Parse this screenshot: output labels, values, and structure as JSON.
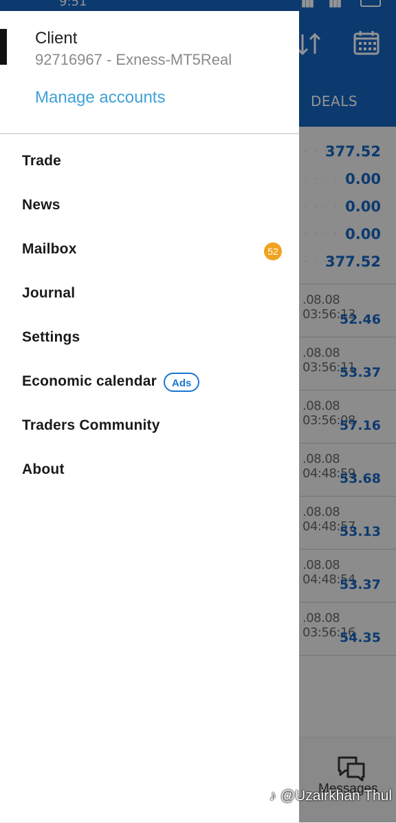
{
  "status_bar": {
    "time": "9:51"
  },
  "drawer": {
    "account": {
      "name": "Client",
      "subtitle": "92716967 - Exness-MT5Real",
      "manage_label": "Manage accounts"
    },
    "menu": [
      {
        "label": "Trade"
      },
      {
        "label": "News"
      },
      {
        "label": "Mailbox",
        "badge": "52"
      },
      {
        "label": "Journal"
      },
      {
        "label": "Settings"
      },
      {
        "label": "Economic calendar",
        "tag": "Ads"
      },
      {
        "label": "Traders Community"
      },
      {
        "label": "About"
      }
    ]
  },
  "background": {
    "tab": "DEALS",
    "summary": [
      "377.52",
      "0.00",
      "0.00",
      "0.00",
      "377.52"
    ],
    "deals": [
      {
        "time": ".08.08 03:56:13",
        "amount": "52.46"
      },
      {
        "time": ".08.08 03:56:11",
        "amount": "53.37"
      },
      {
        "time": ".08.08 03:56:08",
        "amount": "57.16"
      },
      {
        "time": ".08.08 04:48:59",
        "amount": "53.68"
      },
      {
        "time": ".08.08 04:48:57",
        "amount": "53.13"
      },
      {
        "time": ".08.08 04:48:54",
        "amount": "53.37"
      },
      {
        "time": ".08.08 03:56:16",
        "amount": "54.35"
      }
    ],
    "bottom_nav_label": "Messages"
  },
  "watermark": "@Uzairkhan Thul",
  "icons": [
    "sort-icon",
    "calendar-icon",
    "messages-icon",
    "tiktok-icon"
  ],
  "colors": {
    "accent": "#1565c0",
    "link": "#3fa2d6",
    "badge": "#f0a31f"
  }
}
